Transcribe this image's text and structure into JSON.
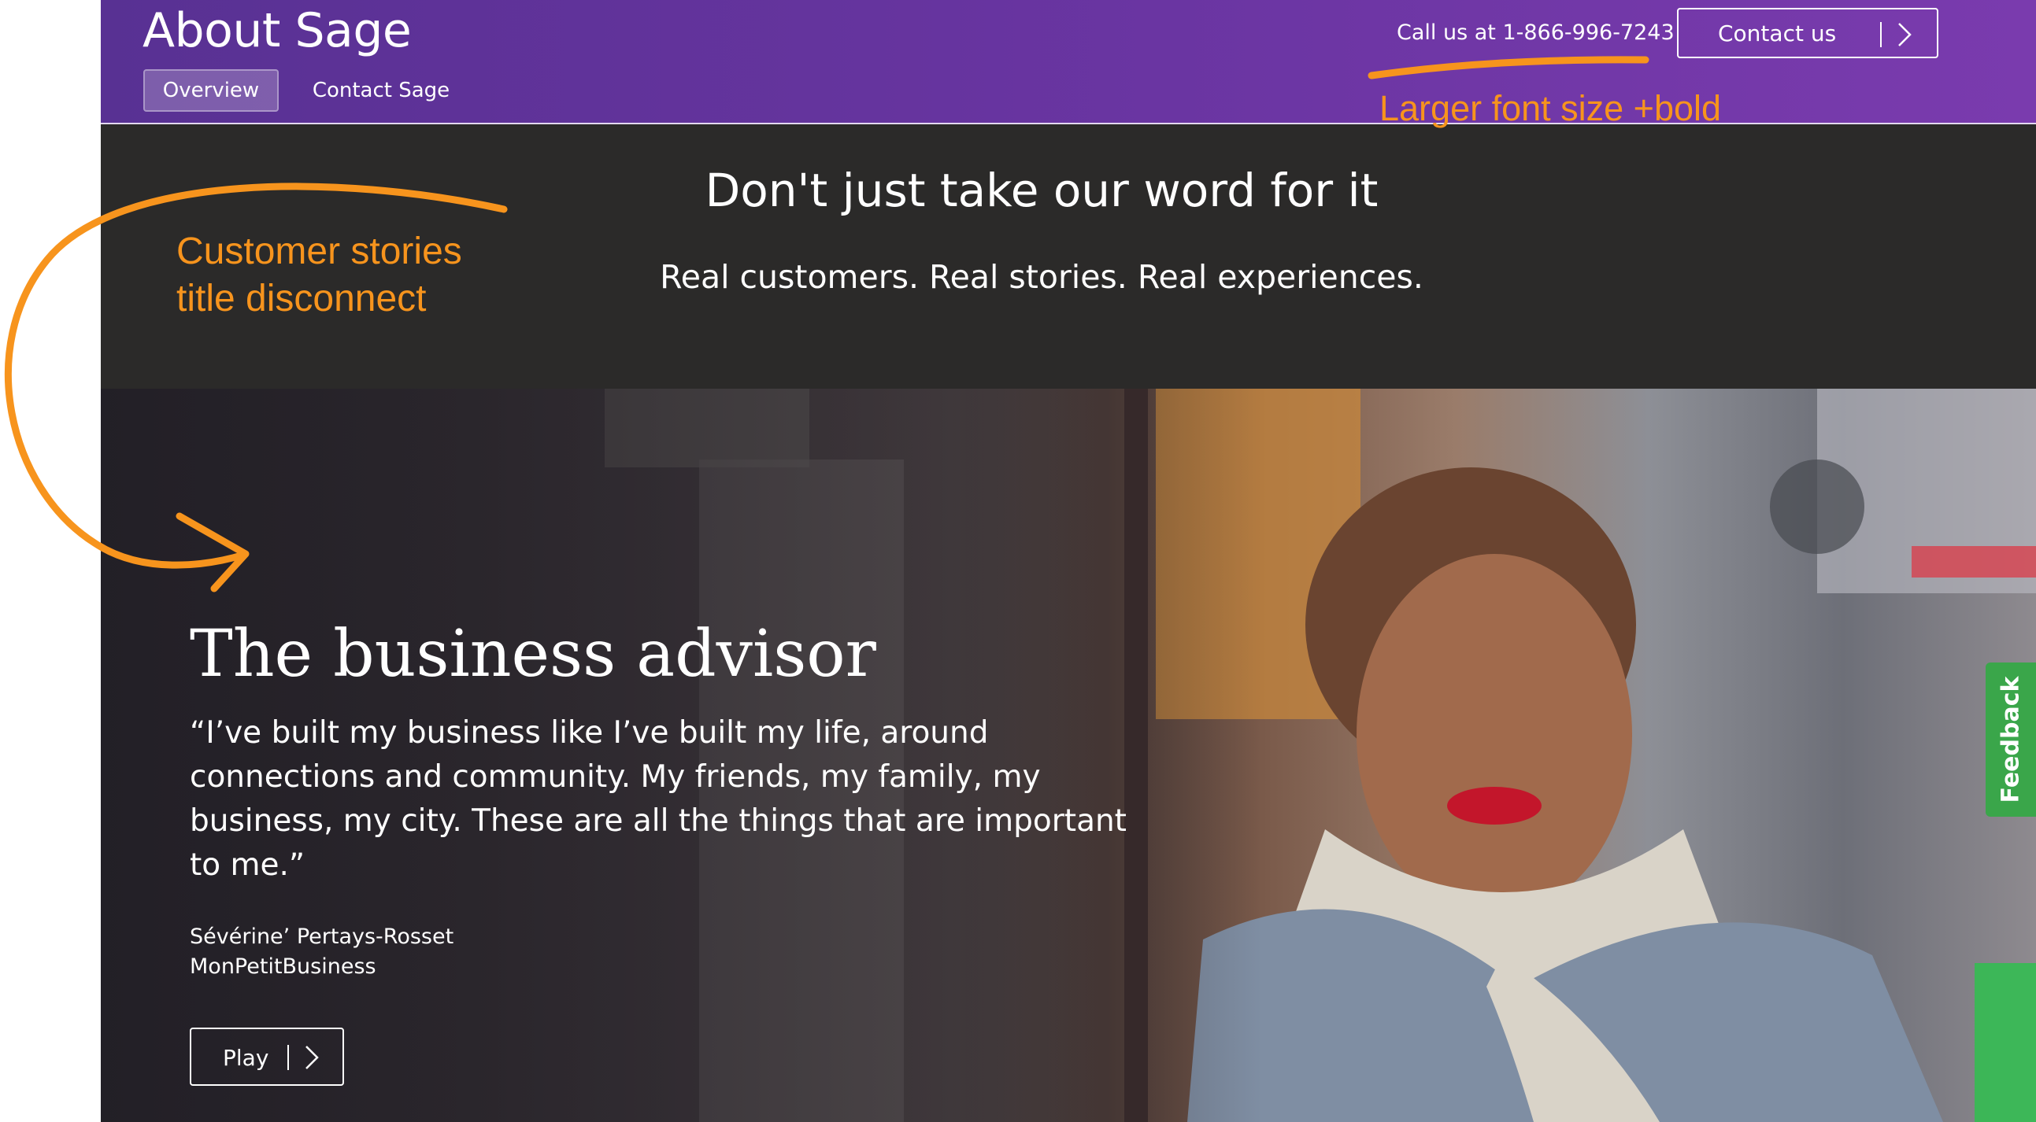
{
  "header": {
    "title": "About Sage",
    "tabs": [
      {
        "label": "Overview",
        "active": true
      },
      {
        "label": "Contact Sage",
        "active": false
      }
    ],
    "phone": "Call us at 1-866-996-7243",
    "contact_button": "Contact us"
  },
  "banner": {
    "title": "Don't just take our word for it",
    "subtitle": "Real customers. Real stories. Real experiences."
  },
  "hero": {
    "title": "The business advisor",
    "quote": "“I’ve built my business like I’ve built my life, around connections and community. My friends, my family, my business, my city. These are all the things that are important to me.”",
    "person_name": "Sévérine’ Pertays-Rosset",
    "company": "MonPetitBusiness",
    "play_button": "Play"
  },
  "feedback_tab": "Feedback",
  "annotations": {
    "left_note_line1": "Customer stories",
    "left_note_line2": "title disconnect",
    "right_note": "Larger font size +bold"
  },
  "colors": {
    "header_purple": "#6a35a2",
    "banner_dark": "#2b2a29",
    "annotation_orange": "#f7941d",
    "feedback_green": "#3aa64a"
  },
  "icons": [
    "chevron-right-icon"
  ]
}
